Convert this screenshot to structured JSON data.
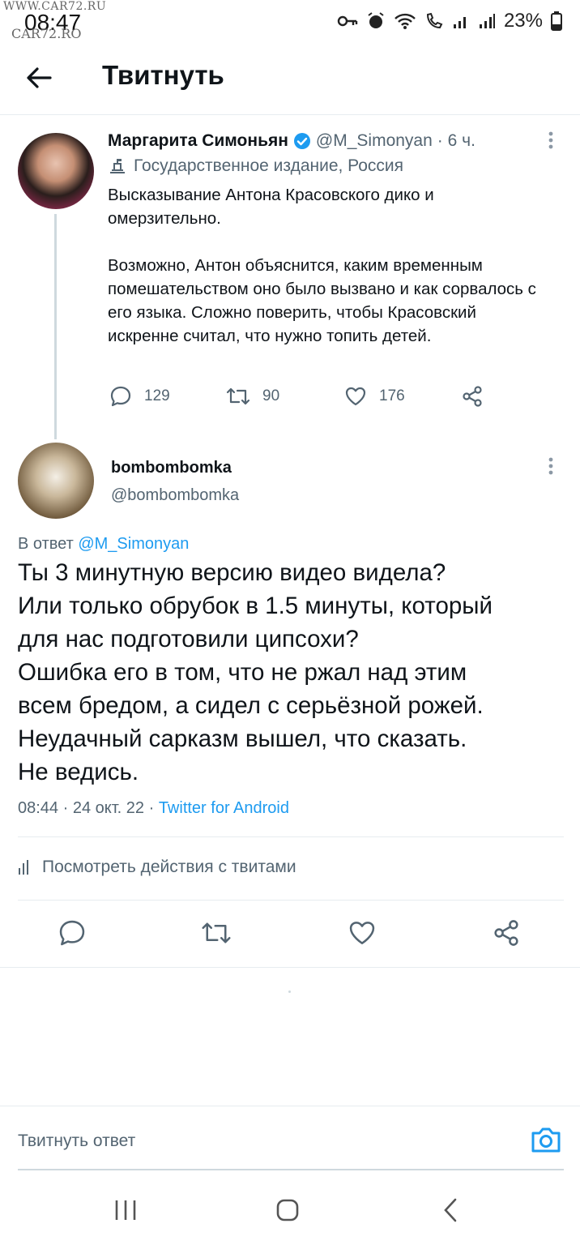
{
  "status_bar": {
    "time": "08:47",
    "battery": "23%",
    "watermark_top": "WWW.CAR72.RU",
    "watermark_bottom": "CAR72.RO"
  },
  "header": {
    "title": "Твитнуть"
  },
  "parent_tweet": {
    "author_name": "Маргарита Симоньян",
    "handle": "@M_Simonyan",
    "time": "· 6 ч.",
    "label": "Государственное издание, Россия",
    "paragraphs": [
      "Высказывание Антона Красовского дико и омерзительно.",
      "Возможно, Антон объяснится, каким временным помешательством оно было вызвано и как сорвалось с его языка. Сложно поверить, чтобы Красовский искренне считал, что нужно топить детей."
    ],
    "replies": "129",
    "retweets": "90",
    "likes": "176"
  },
  "reply_tweet": {
    "author_name": "bombombomka",
    "handle": "@bombombomka",
    "reply_prefix": "В ответ",
    "reply_mention": "@M_Simonyan",
    "text_lines": [
      "Ты 3 минутную версию видео видела?",
      "Или только обрубок в 1.5 минуты, который",
      "для нас подготовили ципсохи?",
      "Ошибка его в том, что не ржал над этим",
      "всем бредом, а сидел с серьёзной рожей.",
      "Неудачный сарказм вышел, что сказать.",
      "Не ведись."
    ],
    "timestamp": "08:44 · 24 окт. 22 ·",
    "source": "Twitter for Android"
  },
  "analytics": {
    "label": "Посмотреть действия с твитами"
  },
  "compose": {
    "placeholder": "Твитнуть ответ"
  },
  "icons": {
    "back": "arrow-left-icon",
    "verified": "verified-badge-icon",
    "label": "government-building-icon",
    "reply": "reply-bubble-icon",
    "retweet": "retweet-icon",
    "like": "heart-icon",
    "share": "share-icon",
    "camera": "camera-icon"
  },
  "colors": {
    "accent": "#1d9bf0",
    "secondary_text": "#536471",
    "divider": "#e7ecf0"
  }
}
